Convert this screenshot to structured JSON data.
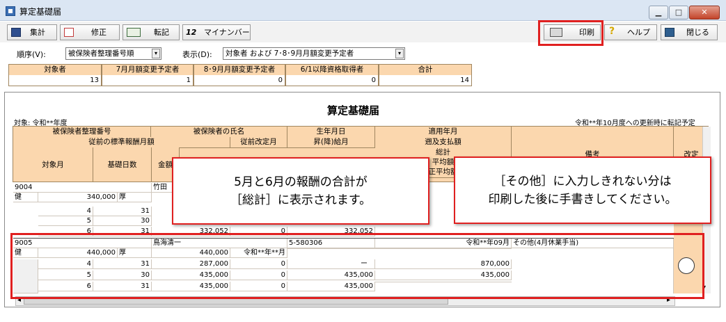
{
  "window": {
    "title": "算定基礎届",
    "min": "▁",
    "max": "□",
    "close": "✕"
  },
  "toolbar": {
    "sum": "集計",
    "edit": "修正",
    "transfer": "転記",
    "mynumber": "マイナンバー",
    "mynumber_icon_text": "12",
    "print": "印刷",
    "help": "ヘルプ",
    "close": "閉じる"
  },
  "options": {
    "order_label": "順序(V):",
    "order_value": "被保険者整理番号順",
    "display_label": "表示(D):",
    "display_value": "対象者 および 7･8･9月月額変更予定者"
  },
  "summary": {
    "headers": [
      "対象者",
      "7月月額変更予定者",
      "8･9月月額変更予定者",
      "6/1以降資格取得者",
      "合計"
    ],
    "values": [
      "13",
      "1",
      "0",
      "0",
      "14"
    ]
  },
  "doc": {
    "title": "算定基礎届",
    "target": "対象:  令和**年度",
    "note": "令和**年10月度への更新時に転記予定"
  },
  "table_headers": {
    "insured_no": "被保険者整理番号",
    "insured_name": "被保険者の氏名",
    "birth": "生年月日",
    "apply_month": "適用年月",
    "prev_std": "従前の標準報酬月額",
    "prev_rev": "従前改定月",
    "raise": "昇(降)給月",
    "retro": "遡及支払額",
    "total": "総計",
    "avg": "平均額",
    "avg2": "正平均額",
    "target_month": "対象月",
    "base_days": "基礎日数",
    "amount": "金額",
    "remarks": "備考",
    "revision": "改定"
  },
  "records": [
    {
      "no": "9004",
      "name": "竹田",
      "ins": "健",
      "std": "340,000",
      "kosei": "厚",
      "rows": [
        {
          "m": "4",
          "d": "31",
          "a": "",
          "b": "",
          "c": ""
        },
        {
          "m": "5",
          "d": "30",
          "a": "",
          "b": "",
          "c": ""
        },
        {
          "m": "6",
          "d": "31",
          "a": "332,052",
          "b": "0",
          "c": "332,052"
        }
      ]
    },
    {
      "no": "9005",
      "name": "鳥海清一",
      "birth": "5-580306",
      "apply": "令和**年09月",
      "remark": "その他(4月休業手当)",
      "ins": "健",
      "std": "440,000",
      "kosei": "厚",
      "std2": "440,000",
      "prev_rev": "令和**年**月",
      "rows": [
        {
          "m": "4",
          "d": "31",
          "a": "287,000",
          "b": "0",
          "c": "ー",
          "t": "870,000"
        },
        {
          "m": "5",
          "d": "30",
          "a": "435,000",
          "b": "0",
          "c": "435,000",
          "t": "435,000"
        },
        {
          "m": "6",
          "d": "31",
          "a": "435,000",
          "b": "0",
          "c": "435,000",
          "t": ""
        }
      ]
    }
  ],
  "callouts": {
    "left_l1": "5月と6月の報酬の合計が",
    "left_l2": "［総計］に表示されます。",
    "right_l1": "［その他］に入力しきれない分は",
    "right_l2": "印刷した後に手書きしてください。"
  },
  "revision_mark": "○",
  "scroll": {
    "left": "◂",
    "right": "▸",
    "down": "▾"
  },
  "colors": {
    "header_bg": "#fbd7ae",
    "highlight": "#e02020",
    "revision_col": "#fbd7ae"
  }
}
